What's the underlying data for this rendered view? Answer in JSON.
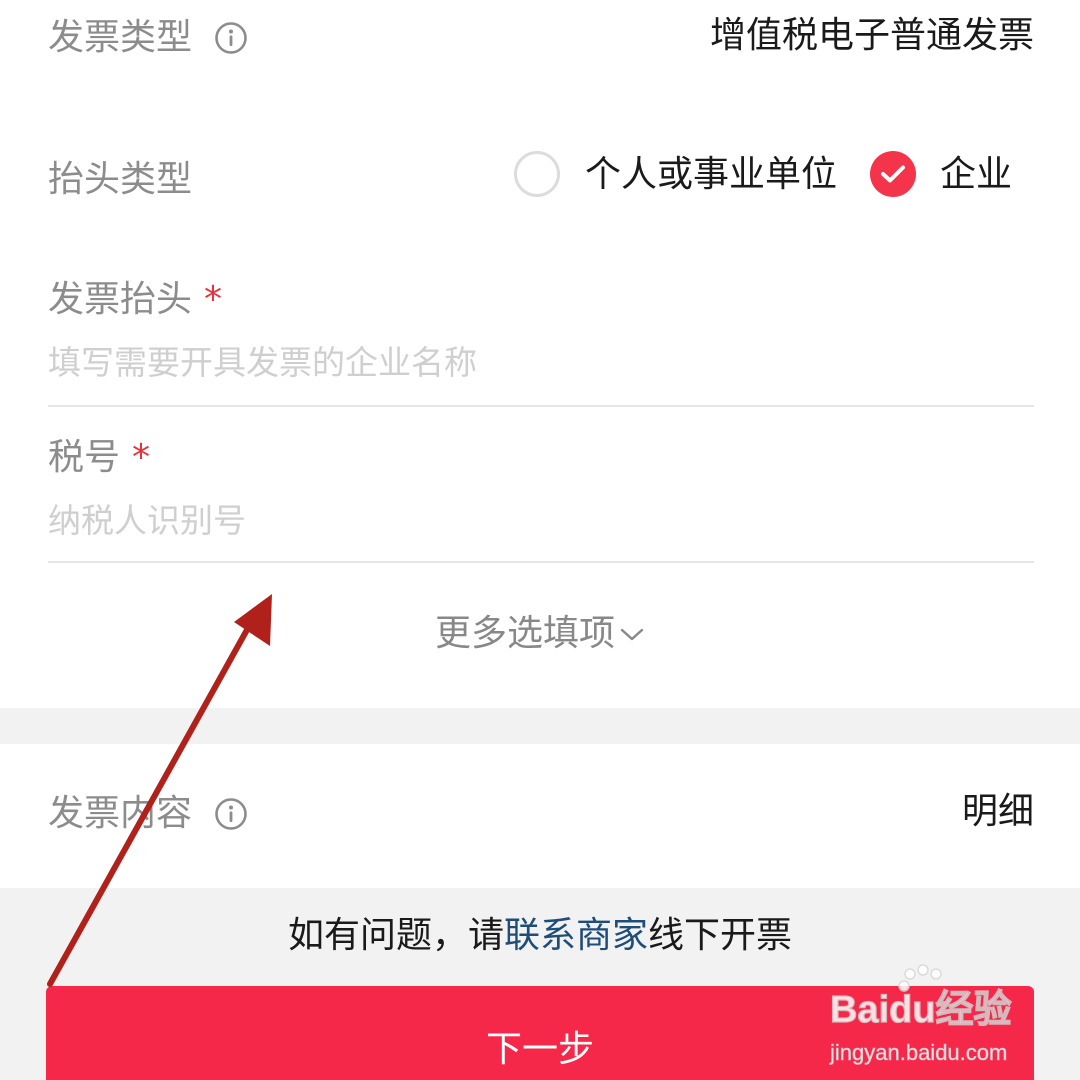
{
  "invoice_type": {
    "label": "发票类型",
    "value": "增值税电子普通发票"
  },
  "header_type": {
    "label": "抬头类型",
    "options": [
      {
        "label": "个人或事业单位",
        "selected": false
      },
      {
        "label": "企业",
        "selected": true
      }
    ]
  },
  "invoice_title": {
    "label": "发票抬头",
    "required_mark": "*",
    "placeholder": "填写需要开具发票的企业名称"
  },
  "tax_id": {
    "label": "税号",
    "required_mark": "*",
    "placeholder": "纳税人识别号"
  },
  "more_options": {
    "label": "更多选填项"
  },
  "invoice_content": {
    "label": "发票内容",
    "value": "明细"
  },
  "help": {
    "prefix": "如有问题，请",
    "link": "联系商家",
    "suffix": "线下开票"
  },
  "next_button": {
    "label": "下一步"
  },
  "watermark": {
    "brand": "Baidu经验",
    "url": "jingyan.baidu.com"
  },
  "colors": {
    "accent": "#f5284a",
    "link": "#1f4d7a",
    "annotation_arrow": "#b0211c"
  }
}
